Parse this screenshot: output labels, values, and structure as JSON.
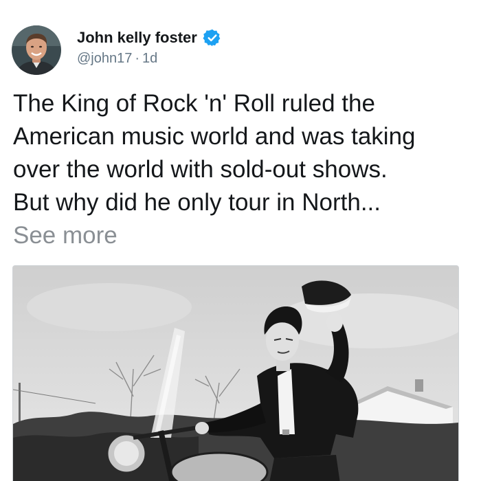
{
  "author": {
    "display_name": "John kelly foster",
    "handle": "@john17",
    "separator": "·",
    "time": "1d",
    "verified": true,
    "verified_color": "#1da1f2"
  },
  "avatar": {
    "icon": "person-avatar"
  },
  "tweet": {
    "text": "The King of Rock 'n' Roll ruled the\nAmerican music world and was taking\nover the world with sold-out shows.\nBut why did he only tour in North...",
    "see_more": "See more"
  },
  "media": {
    "type": "photo",
    "icon": "photo-man-on-motorcycle",
    "style": "black-and-white"
  }
}
